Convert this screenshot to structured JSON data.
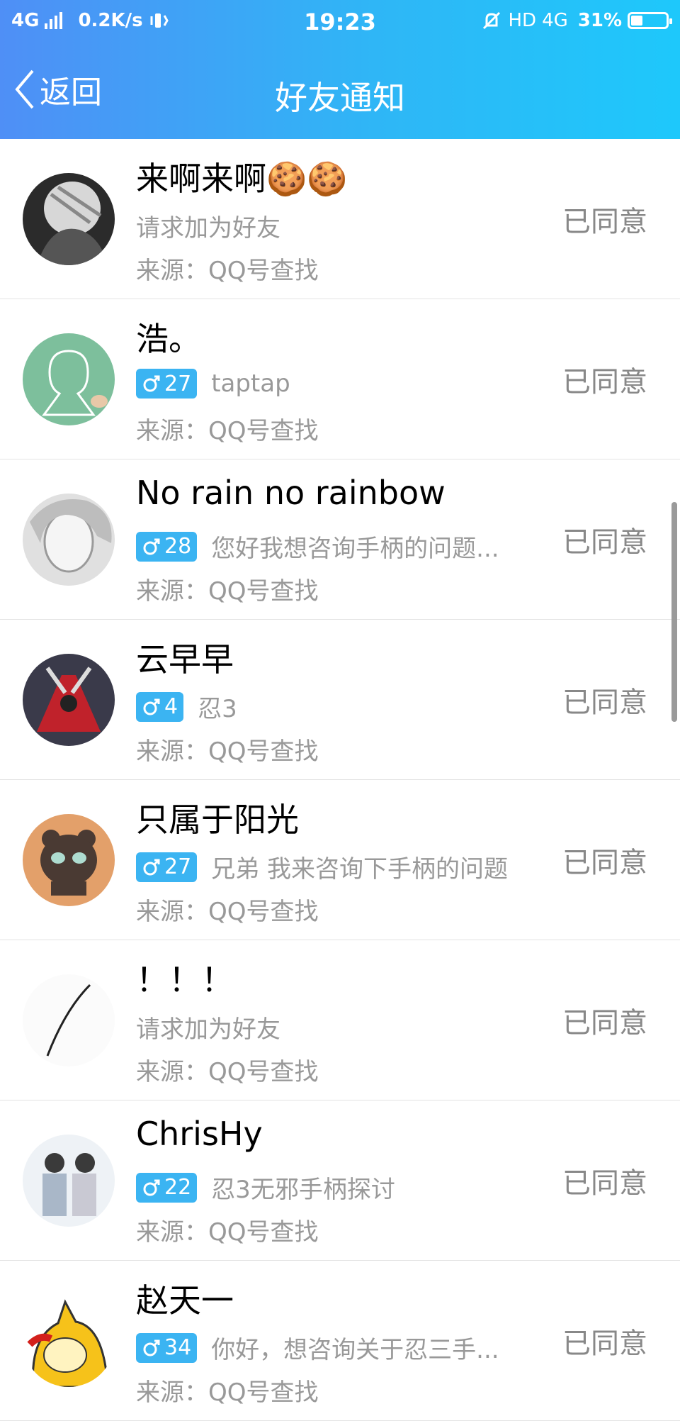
{
  "statusbar": {
    "network": "4G",
    "speed": "0.2K/s",
    "time": "19:23",
    "hd": "HD",
    "network2": "4G",
    "battery": "31%",
    "battery_level": 0.31
  },
  "navbar": {
    "back_label": "返回",
    "title": "好友通知"
  },
  "items": [
    {
      "name": "来啊来啊🍪🍪",
      "badge": "",
      "message": "请求加为好友",
      "source": "来源：QQ号查找",
      "status": "已同意"
    },
    {
      "name": "浩。",
      "badge": "27",
      "message": "taptap",
      "source": "来源：QQ号查找",
      "status": "已同意"
    },
    {
      "name": "No rain no rainbow",
      "badge": "28",
      "message": "您好我想咨询手柄的问题...",
      "source": "来源：QQ号查找",
      "status": "已同意"
    },
    {
      "name": "云早早",
      "badge": "4",
      "message": "忍3",
      "source": "来源：QQ号查找",
      "status": "已同意"
    },
    {
      "name": "只属于阳光",
      "badge": "27",
      "message": "兄弟 我来咨询下手柄的问题",
      "source": "来源：QQ号查找",
      "status": "已同意"
    },
    {
      "name": "！！！",
      "badge": "",
      "message": "请求加为好友",
      "source": "来源：QQ号查找",
      "status": "已同意"
    },
    {
      "name": "ChrisHy",
      "badge": "22",
      "message": "忍3无邪手柄探讨",
      "source": "来源：QQ号查找",
      "status": "已同意"
    },
    {
      "name": "赵天一",
      "badge": "34",
      "message": "你好，想咨询关于忍三手...",
      "source": "来源：QQ号查找",
      "status": "已同意"
    }
  ],
  "colors": {
    "header_start": "#4f8ff6",
    "header_end": "#1ec8fb",
    "badge": "#3bb4f2",
    "muted_text": "#999999"
  }
}
